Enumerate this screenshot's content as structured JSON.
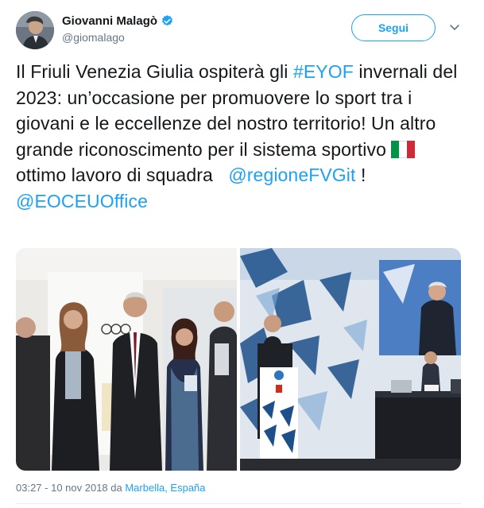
{
  "user": {
    "name": "Giovanni Malagò",
    "handle": "@giomalago",
    "verified_icon": "verified-badge-icon"
  },
  "follow_label": "Segui",
  "menu_icon": "chevron-down-icon",
  "tweet": {
    "t1": "Il Friuli Venezia Giulia ospiterà gli ",
    "hashtag": "#EYOF",
    "t2": " invernali del 2023: un’occasione per promuovere lo sport tra i giovani e le eccellenze del nostro territorio! Un altro grande riconoscimento per il sistema sportivo ",
    "flag_icon": "italy-flag-icon",
    "t3": " ottimo lavoro di squadra   ",
    "mention1": "@regioneFVGit",
    "t4": " ! ",
    "mention2": "@EOCEUOffice"
  },
  "timestamp": "03:27 - 10 nov 2018 da ",
  "location": "Marbella, España",
  "colors": {
    "accent": "#1da1f2",
    "text": "#14171a",
    "muted": "#657786",
    "flag_green": "#009246",
    "flag_white": "#ffffff",
    "flag_red": "#ce2b37"
  }
}
